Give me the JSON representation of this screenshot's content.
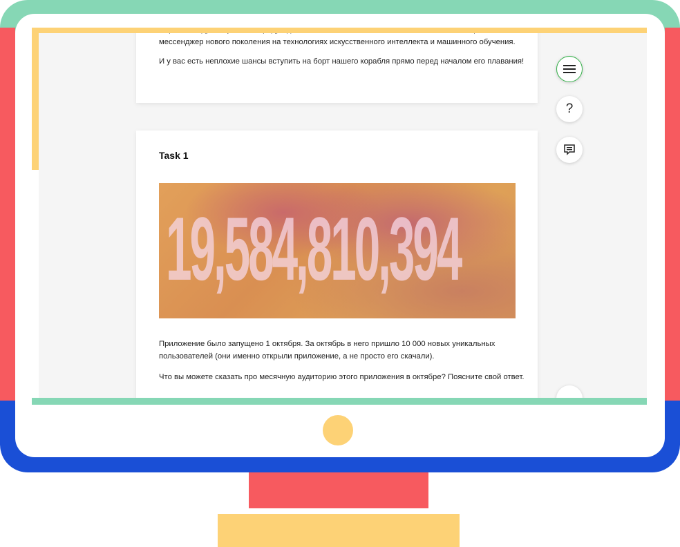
{
  "card_intro": {
    "paragraph_1": "мире команду и научились предугадывать то, что хочет написать пользователь. Мы строим мессенджер нового поколения на технологиях искусственного интеллекта и машинного обучения.",
    "paragraph_2": "И у вас есть неплохие шансы вступить на борт нашего корабля прямо перед началом его плавания!"
  },
  "task": {
    "title": "Task 1",
    "banner_number": "19,584,810,394",
    "paragraph_1": "Приложение было запущено 1 октября. За октябрь в него пришло 10 000 новых уникальных пользователей (они именно открыли приложение, а не просто его скачали).",
    "paragraph_2": "Что вы можете сказать про месячную аудиторию этого приложения в октябре? Поясните свой ответ."
  },
  "sidebar_buttons": {
    "menu_icon": "hamburger-menu-icon",
    "help_label": "?",
    "chat_icon": "chat-icon"
  },
  "colors": {
    "frame_green": "#86d7b5",
    "frame_red": "#f75a5f",
    "frame_blue": "#1a4fd6",
    "frame_yellow": "#fdd276",
    "accent_green": "#35b24a"
  }
}
